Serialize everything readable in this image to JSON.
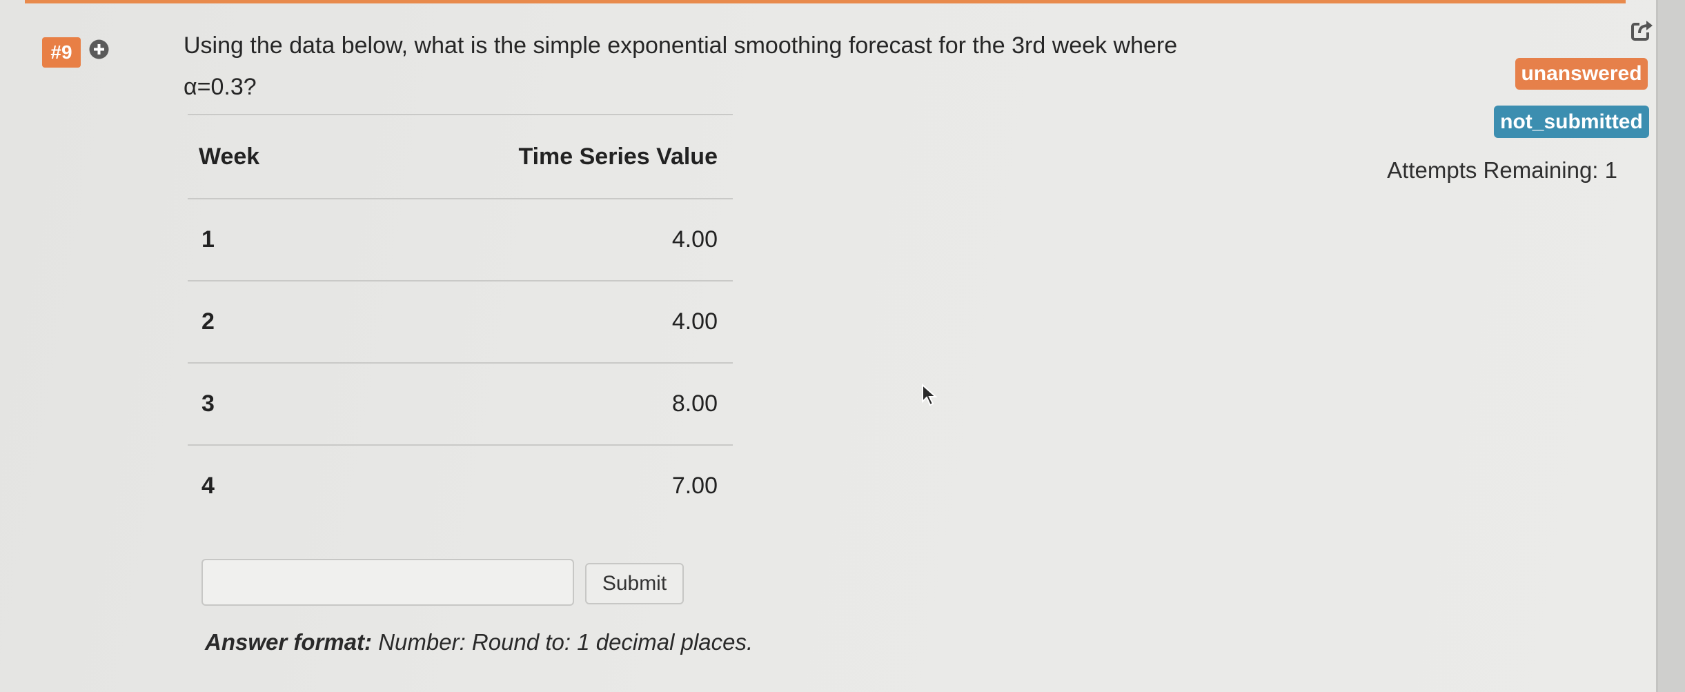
{
  "question": {
    "number": "#9",
    "text": "Using the data below, what is the simple exponential smoothing forecast for the 3rd week where α=0.3?"
  },
  "table": {
    "headers": [
      "Week",
      "Time Series Value"
    ],
    "rows": [
      {
        "week": "1",
        "value": "4.00"
      },
      {
        "week": "2",
        "value": "4.00"
      },
      {
        "week": "3",
        "value": "8.00"
      },
      {
        "week": "4",
        "value": "7.00"
      }
    ]
  },
  "answer": {
    "value": "",
    "submit_label": "Submit",
    "format_label": "Answer format:",
    "format_text": "Number: Round to: 1 decimal places."
  },
  "status": {
    "answer_state": "unanswered",
    "submit_state": "not_submitted",
    "attempts": "Attempts Remaining: 1"
  },
  "icons": {
    "expand": "plus-circle-icon",
    "share": "share-icon",
    "cursor": "mouse-pointer-icon"
  },
  "colors": {
    "accent_orange": "#e87f45",
    "status_blue": "#3c8eb0"
  }
}
